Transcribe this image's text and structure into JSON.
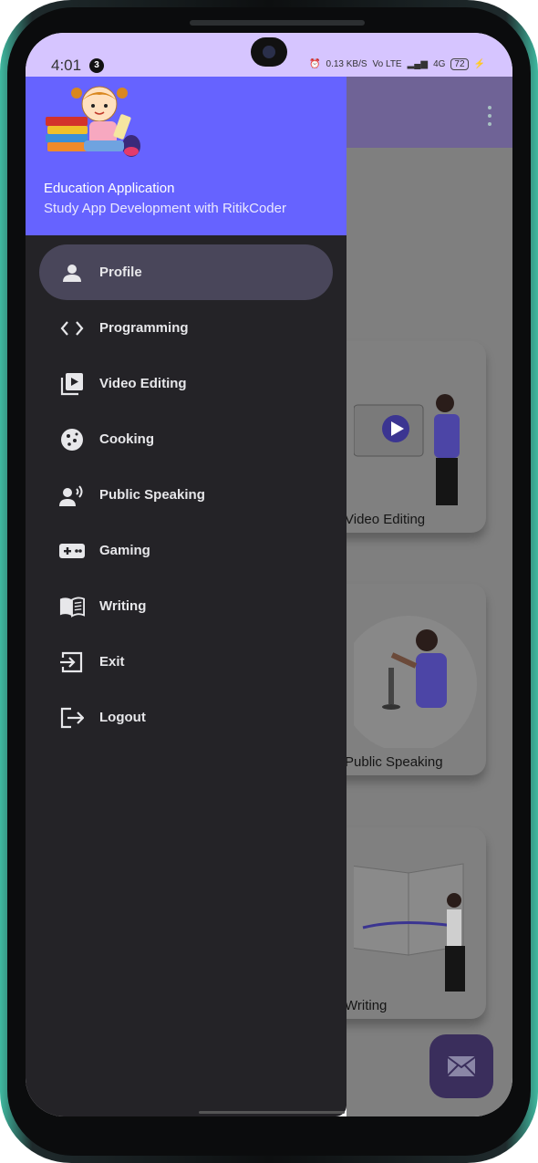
{
  "status_bar": {
    "time": "4:01",
    "notification_count": "3",
    "net_speed": "0.13 KB/S",
    "network": "Vo LTE",
    "signal": "4G",
    "battery": "72"
  },
  "drawer": {
    "header": {
      "title": "Education Application",
      "subtitle": "Study App Development with RitikCoder"
    },
    "items": [
      {
        "label": "Profile",
        "icon": "person-icon",
        "selected": true
      },
      {
        "label": "Programming",
        "icon": "code-icon",
        "selected": false
      },
      {
        "label": "Video Editing",
        "icon": "video-library-icon",
        "selected": false
      },
      {
        "label": "Cooking",
        "icon": "cookie-icon",
        "selected": false
      },
      {
        "label": "Public Speaking",
        "icon": "record-voice-icon",
        "selected": false
      },
      {
        "label": "Gaming",
        "icon": "gamepad-icon",
        "selected": false
      },
      {
        "label": "Writing",
        "icon": "book-icon",
        "selected": false
      },
      {
        "label": "Exit",
        "icon": "exit-icon",
        "selected": false
      },
      {
        "label": "Logout",
        "icon": "logout-icon",
        "selected": false
      }
    ]
  },
  "cards": [
    {
      "label": "Video Editing"
    },
    {
      "label": "Public Speaking"
    },
    {
      "label": "Writing"
    }
  ],
  "fab": {
    "icon": "mail-icon"
  },
  "colors": {
    "status_bar": "#d6c5ff",
    "drawer_header": "#6663ff",
    "drawer_bg": "#242327",
    "selected_item": "#49465a",
    "fab": "#3a2e5c"
  }
}
